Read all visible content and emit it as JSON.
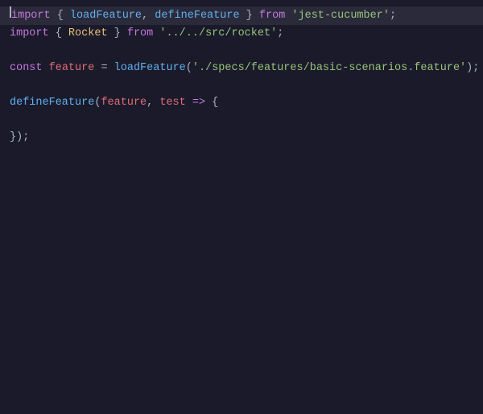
{
  "editor": {
    "background": "#1a1a2a",
    "lines": [
      {
        "id": "line1",
        "tokens": [
          {
            "type": "kw-import",
            "text": "import"
          },
          {
            "type": "plain",
            "text": " { "
          },
          {
            "type": "func-name",
            "text": "loadFeature"
          },
          {
            "type": "plain",
            "text": ", "
          },
          {
            "type": "func-name",
            "text": "defineFeature"
          },
          {
            "type": "plain",
            "text": " } "
          },
          {
            "type": "kw-from",
            "text": "from"
          },
          {
            "type": "plain",
            "text": " "
          },
          {
            "type": "string",
            "text": "'jest-cucumber'"
          },
          {
            "type": "plain",
            "text": ";"
          }
        ],
        "highlighted": true
      },
      {
        "id": "line2",
        "tokens": [
          {
            "type": "kw-import",
            "text": "import"
          },
          {
            "type": "plain",
            "text": " { "
          },
          {
            "type": "prop",
            "text": "Rocket"
          },
          {
            "type": "plain",
            "text": " } "
          },
          {
            "type": "kw-from",
            "text": "from"
          },
          {
            "type": "plain",
            "text": " "
          },
          {
            "type": "string",
            "text": "'../../src/rocket'"
          },
          {
            "type": "plain",
            "text": ";"
          }
        ],
        "highlighted": false
      },
      {
        "id": "line3",
        "tokens": [],
        "empty": true,
        "highlighted": false
      },
      {
        "id": "line4",
        "tokens": [
          {
            "type": "kw-const",
            "text": "const"
          },
          {
            "type": "plain",
            "text": " "
          },
          {
            "type": "var-name",
            "text": "feature"
          },
          {
            "type": "plain",
            "text": " = "
          },
          {
            "type": "func-name",
            "text": "loadFeature"
          },
          {
            "type": "plain",
            "text": "("
          },
          {
            "type": "string",
            "text": "'./specs/features/basic-scenarios.feature'"
          },
          {
            "type": "plain",
            "text": ");"
          }
        ],
        "highlighted": false
      },
      {
        "id": "line5",
        "tokens": [],
        "empty": true,
        "highlighted": false
      },
      {
        "id": "line6",
        "tokens": [
          {
            "type": "func-name",
            "text": "defineFeature"
          },
          {
            "type": "plain",
            "text": "("
          },
          {
            "type": "var-name",
            "text": "feature"
          },
          {
            "type": "plain",
            "text": ", "
          },
          {
            "type": "var-name",
            "text": "test"
          },
          {
            "type": "plain",
            "text": " "
          },
          {
            "type": "kw-arrow",
            "text": "=>"
          },
          {
            "type": "plain",
            "text": " {"
          }
        ],
        "highlighted": false
      },
      {
        "id": "line7",
        "tokens": [],
        "empty": true,
        "highlighted": false
      },
      {
        "id": "line8",
        "tokens": [
          {
            "type": "plain",
            "text": "});"
          }
        ],
        "highlighted": false
      }
    ]
  }
}
